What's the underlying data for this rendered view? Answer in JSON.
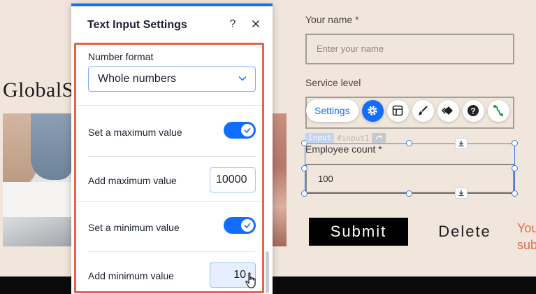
{
  "site": {
    "brand": "GlobalS",
    "form": {
      "name_label": "Your name *",
      "name_placeholder": "Enter your name",
      "service_label": "Service level",
      "employee_label": "Employee count *",
      "employee_value": "100",
      "submit_label": "Submit",
      "delete_label": "Delete",
      "error_line1": "You",
      "error_line2": "sub"
    }
  },
  "selection": {
    "element_type": "Input",
    "element_id": "#input1"
  },
  "toolbar": {
    "settings_label": "Settings",
    "icons": [
      "gear-icon",
      "layout-icon",
      "brush-icon",
      "animation-icon",
      "help-icon",
      "connect-icon"
    ]
  },
  "panel": {
    "title": "Text Input Settings",
    "help_label": "?",
    "number_format": {
      "title": "Number format",
      "selected": "Whole numbers"
    },
    "max_toggle": {
      "label": "Set a maximum value",
      "on": true
    },
    "max_value": {
      "label": "Add maximum value",
      "value": "10000"
    },
    "min_toggle": {
      "label": "Set a minimum value",
      "on": true
    },
    "min_value": {
      "label": "Add minimum value",
      "value": "10"
    }
  },
  "colors": {
    "accent": "#116dff",
    "highlight_border": "#e8624a",
    "page_bg": "#f1e6dc",
    "error": "#e2694f"
  }
}
